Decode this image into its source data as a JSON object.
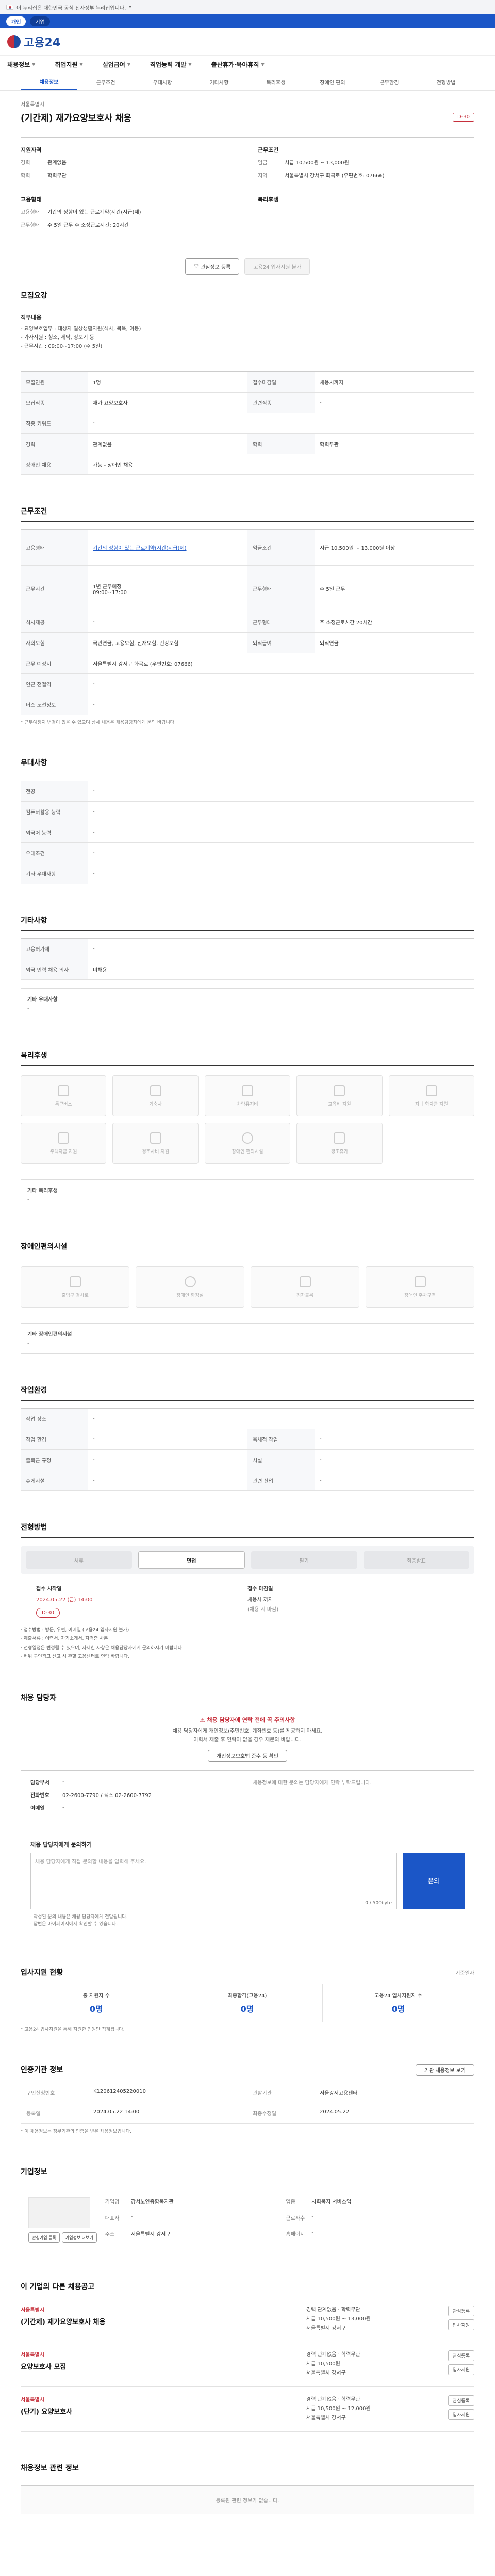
{
  "gov_banner": {
    "text": "이 누리집은 대한민국 공식 전자정부 누리집입니다.",
    "chevron": "chevron-down-icon"
  },
  "blue_bar": {
    "pill": "개인",
    "dark": "기업"
  },
  "logo": {
    "text": "고용24"
  },
  "gnb": [
    {
      "label": "채용정보"
    },
    {
      "label": "취업지원"
    },
    {
      "label": "실업급여"
    },
    {
      "label": "직업능력 개발"
    },
    {
      "label": "출산휴가·육아휴직"
    }
  ],
  "subtabs": [
    {
      "label": "채용정보",
      "active": true
    },
    {
      "label": "근무조건"
    },
    {
      "label": "우대사항"
    },
    {
      "label": "기타사항"
    },
    {
      "label": "복리후생"
    },
    {
      "label": "장애인 편의"
    },
    {
      "label": "근무환경"
    },
    {
      "label": "전형방법"
    }
  ],
  "job": {
    "company": "서울특별시",
    "title": "(기간제) 재가요양보호사 채용",
    "dday": "D-30"
  },
  "summary": {
    "left_h1": "지원자격",
    "rows1": [
      {
        "k": "경력",
        "v": "관계없음"
      },
      {
        "k": "학력",
        "v": "학력무관"
      }
    ],
    "left_h2": "고용형태",
    "rows2": [
      {
        "k": "고용형태",
        "v": "기간의 정함이 있는 근로계약(시간(시급)제)"
      },
      {
        "k": "근무형태",
        "v": "주 5일 근무 주 소정근로시간: 20시간"
      }
    ],
    "right_h1": "근무조건",
    "rows3": [
      {
        "k": "임금",
        "v": "시급 10,500원 ~ 13,000원"
      },
      {
        "k": "지역",
        "v": "서울특별시 강서구 화곡로 (우편번호: 07666)"
      }
    ],
    "right_h2": "복리후생"
  },
  "actions": {
    "share": "관심정보 등록",
    "apply": "고용24 입사지원 불가"
  },
  "sec_recruit": {
    "title": "모집요강",
    "duties_h": "직무내용",
    "duties": [
      "- 요양보호업무 : 대상자 일상생활지원(식사, 목욕, 이동)",
      "- 가사지원 : 청소, 세탁, 장보기 등",
      "- 근무시간 : 09:00~17:00 (주 5일)"
    ],
    "grid": [
      {
        "k": "모집인원",
        "v": "1명"
      },
      {
        "k": "접수마감일",
        "v": "채용시까지"
      },
      {
        "k": "모집직종",
        "v": "재가 요양보호사"
      },
      {
        "k": "관련직종",
        "v": "-"
      },
      {
        "k": "직종 키워드",
        "v": "-"
      },
      {
        "k": "",
        "v": ""
      },
      {
        "k": "경력",
        "v": "관계없음"
      },
      {
        "k": "학력",
        "v": "학력무관"
      },
      {
        "k": "장애인 채용",
        "v": "가능 - 장애인 채용"
      }
    ]
  },
  "sec_condition": {
    "title": "근무조건",
    "grid": [
      {
        "k": "고용형태",
        "v": "기간의 정함이 있는 근로계약(시간(시급)제)"
      },
      {
        "k": "임금조건",
        "v": "시급 10,500원 ~ 13,000원 이상"
      },
      {
        "k": "근무시간",
        "v": "1년 근무예정\n09:00~17:00"
      },
      {
        "k": "근무형태",
        "v": "주 5일 근무"
      },
      {
        "k": "식사제공",
        "v": "-"
      },
      {
        "k": "근무형태",
        "v": "주 소정근로시간 20시간"
      },
      {
        "k": "사회보험",
        "v": "국민연금, 고용보험, 산재보험, 건강보험"
      },
      {
        "k": "퇴직급여",
        "v": "퇴직연금"
      },
      {
        "k": "근무 예정지",
        "v": "서울특별시 강서구 화곡로 (우편번호: 07666)"
      },
      {
        "k": "인근 전철역",
        "v": "-"
      },
      {
        "k": "버스 노선정보",
        "v": "-"
      }
    ],
    "note": "* 근무예정지 변경이 있을 수 있으며 상세 내용은 채용담당자에게 문의 바랍니다."
  },
  "sec_pref": {
    "title": "우대사항",
    "grid": [
      {
        "k": "전공",
        "v": "-"
      },
      {
        "k": "컴퓨터활용 능력",
        "v": "-"
      },
      {
        "k": "외국어 능력",
        "v": "-"
      },
      {
        "k": "우대조건",
        "v": "-"
      },
      {
        "k": "기타 우대사항",
        "v": "-"
      }
    ]
  },
  "sec_etc": {
    "title": "기타사항",
    "grid": [
      {
        "k": "고용허가제",
        "v": "-"
      },
      {
        "k": "외국 인력 채용 의사",
        "v": "미채용"
      }
    ],
    "box_h": "기타 우대사항",
    "box_v": "-"
  },
  "sec_welfare": {
    "title": "복리후생",
    "tiles": [
      {
        "label": "통근버스",
        "icon": "bus-icon"
      },
      {
        "label": "기숙사",
        "icon": "dorm-icon"
      },
      {
        "label": "차량유지비",
        "icon": "car-icon"
      },
      {
        "label": "교육비 지원",
        "icon": "education-icon"
      },
      {
        "label": "자녀 학자금 지원",
        "icon": "scholarship-icon"
      },
      {
        "label": "주택자금 지원",
        "icon": "house-icon"
      },
      {
        "label": "경조사비 지원",
        "icon": "gift-icon"
      },
      {
        "label": "장애인 편의시설",
        "icon": "accessibility-icon"
      },
      {
        "label": "경조휴가",
        "icon": "calendar-icon"
      }
    ],
    "box_h": "기타 복리후생",
    "box_v": "-"
  },
  "sec_disability": {
    "title": "장애인편의시설",
    "tiles": [
      {
        "label": "출입구 경사로",
        "icon": "ramp-icon"
      },
      {
        "label": "장애인 화장실",
        "icon": "restroom-icon"
      },
      {
        "label": "점자블록",
        "icon": "braille-icon"
      },
      {
        "label": "장애인 주차구역",
        "icon": "parking-icon"
      }
    ],
    "box_h": "기타 장애인편의시설",
    "box_v": "-"
  },
  "sec_env": {
    "title": "작업환경",
    "grid": [
      {
        "k": "작업 장소",
        "v": "-"
      },
      {
        "k": "",
        "v": ""
      },
      {
        "k": "작업 환경",
        "v": "-"
      },
      {
        "k": "육체적 작업",
        "v": "-"
      },
      {
        "k": "출퇴근 규정",
        "v": "-"
      },
      {
        "k": "시설",
        "v": "-"
      },
      {
        "k": "휴게시설",
        "v": "-"
      },
      {
        "k": "관련 산업",
        "v": "-"
      }
    ]
  },
  "sec_select": {
    "title": "전형방법",
    "steps": [
      "서류",
      "면접",
      "필기",
      "최종발표"
    ],
    "start_k": "접수 시작일",
    "start_v": "2024.05.22 (금) 14:00",
    "end_k": "접수 마감일",
    "end_v": "채용시 까지",
    "end_sub": "(채용 시 마감)",
    "dday": "D-30",
    "bullets": [
      "· 접수방법 : 방문, 우편, 이메일 (고용24 입사지원 불가)",
      "· 제출서류 : 이력서, 자기소개서, 자격증 사본",
      "· 전형일정은 변경될 수 있으며, 자세한 사항은 채용담당자에게 문의하시기 바랍니다.",
      "· 허위 구인광고 신고 시 관할 고용센터로 연락 바랍니다."
    ]
  },
  "sec_contact": {
    "title": "채용 담당자",
    "alert_t": "채용 담당자에 연락 전에 꼭 주의사항",
    "alert_d": "채용 담당자에게 개인정보(주민번호, 계좌번호 등)를 제공하지 마세요.\n이력서 제출 후 연락이 없을 경우 재문의 바랍니다.",
    "alert_btn": "개인정보보호법 준수 등 확인",
    "rows": [
      {
        "k": "담당부서",
        "v": "-"
      },
      {
        "k": "전화번호",
        "v": "02-2600-7790 / 팩스 02-2600-7792"
      },
      {
        "k": "이메일",
        "v": "-"
      }
    ],
    "right_note": "채용정보에 대한 문의는 담당자에게 연락 부탁드립니다.",
    "inq_h": "채용 담당자에게 문의하기",
    "inq_placeholder": "채용 담당자에게 직접 문의할 내용을 입력해 주세요.",
    "inq_count": "0 / 500byte",
    "inq_btn": "문의",
    "inq_notes": [
      "· 작성된 문의 내용은 채용 담당자에게 전달됩니다.",
      "· 답변은 마이페이지에서 확인할 수 있습니다."
    ]
  },
  "sec_applicant": {
    "title": "입사지원 현황",
    "sub": "기준일자",
    "cells": [
      {
        "k": "총 지원자 수",
        "v": "0명"
      },
      {
        "k": "최종합격(고용24)",
        "v": "0명"
      },
      {
        "k": "고용24 입사지원자 수",
        "v": "0명"
      }
    ],
    "note": "* 고용24 입사지원을 통해 지원한 인원만 집계됩니다."
  },
  "sec_agency": {
    "title": "인증기관 정보",
    "btn": "기관 채용정보 보기",
    "rows": [
      {
        "k": "구인신청번호",
        "v": "K120612405220010"
      },
      {
        "k": "관할기관",
        "v": "서울강서고용센터"
      },
      {
        "k": "등록일",
        "v": "2024.05.22 14:00"
      },
      {
        "k": "최종수정일",
        "v": "2024.05.22"
      }
    ],
    "note": "* 이 채용정보는 정부기관의 인증을 받은 채용정보입니다."
  },
  "sec_corp": {
    "title": "기업정보",
    "btns": [
      "관심기업 등록",
      "기업정보 더보기"
    ],
    "info": [
      {
        "k": "기업명",
        "v": "강서노인종합복지관"
      },
      {
        "k": "업종",
        "v": "사회복지 서비스업"
      },
      {
        "k": "대표자",
        "v": "-"
      },
      {
        "k": "근로자수",
        "v": "-"
      },
      {
        "k": "주소",
        "v": "서울특별시 강서구"
      },
      {
        "k": "홈페이지",
        "v": "-"
      }
    ]
  },
  "sec_related": {
    "title": "이 기업의 다른 채용공고",
    "items": [
      {
        "org": "서울특별시",
        "title": "(기간제) 재가요양보호사 채용",
        "meta": [
          "경력 관계없음 · 학력무관",
          "시급 10,500원 ~ 13,000원",
          "서울특별시 강서구"
        ],
        "btns": [
          "관심등록",
          "입사지원"
        ]
      },
      {
        "org": "서울특별시",
        "title": "요양보호사 모집",
        "meta": [
          "경력 관계없음 · 학력무관",
          "시급 10,500원",
          "서울특별시 강서구"
        ],
        "btns": [
          "관심등록",
          "입사지원"
        ]
      },
      {
        "org": "서울특별시",
        "title": "(단기) 요양보호사",
        "meta": [
          "경력 관계없음 · 학력무관",
          "시급 10,500원 ~ 12,000원",
          "서울특별시 강서구"
        ],
        "btns": [
          "관심등록",
          "입사지원"
        ]
      }
    ]
  },
  "sec_footer": {
    "title": "채용정보 관련 정보",
    "empty": "등록된 관련 정보가 없습니다."
  }
}
